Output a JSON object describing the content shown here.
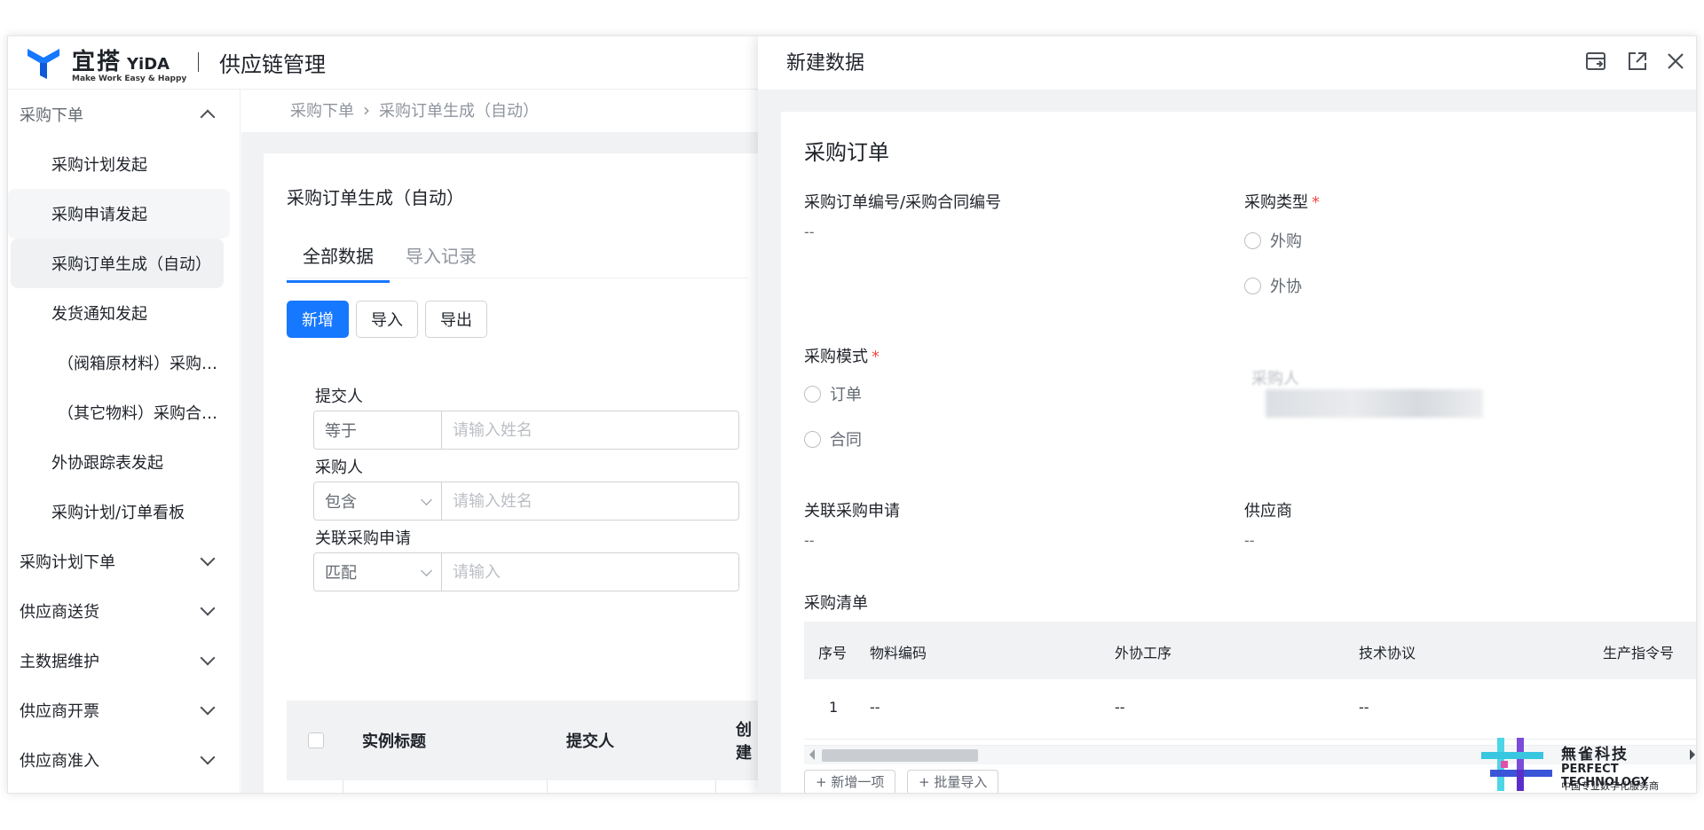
{
  "header": {
    "brand_cn": "宜搭",
    "brand_en": "YiDA",
    "brand_slogan": "Make Work Easy & Happy",
    "app_title": "供应链管理",
    "brand_color": "#1677ff"
  },
  "sidebar": {
    "groups": [
      {
        "label": "采购下单",
        "expanded": true
      },
      {
        "label": "采购计划下单"
      },
      {
        "label": "供应商送货"
      },
      {
        "label": "主数据维护"
      },
      {
        "label": "供应商开票"
      },
      {
        "label": "供应商准入"
      }
    ],
    "items": [
      "采购计划发起",
      "采购申请发起",
      "采购订单生成（自动）",
      "发货通知发起",
      "（阀箱原材料）采购…",
      "（其它物料）采购合…",
      "外协跟踪表发起",
      "采购计划/订单看板"
    ],
    "active_item": "采购订单生成（自动）"
  },
  "main": {
    "breadcrumb": [
      "采购下单",
      "采购订单生成（自动）"
    ],
    "page_title": "采购订单生成（自动）",
    "tabs": [
      "全部数据",
      "导入记录"
    ],
    "buttons": {
      "add": "新增",
      "import": "导入",
      "export": "导出"
    },
    "filters": [
      {
        "label": "提交人",
        "operator": "等于",
        "placeholder": "请输入姓名"
      },
      {
        "label": "采购人",
        "operator": "包含",
        "placeholder": "请输入姓名"
      },
      {
        "label": "关联采购申请",
        "operator": "匹配",
        "placeholder": "请输入"
      }
    ],
    "table_headers": [
      "实例标题",
      "提交人",
      "创建"
    ]
  },
  "drawer": {
    "title": "新建数据",
    "form_title": "采购订单",
    "fields": {
      "order_no_label": "采购订单编号/采购合同编号",
      "order_no_value": "--",
      "purchase_type_label": "采购类型",
      "purchase_type_options": [
        "外购",
        "外协"
      ],
      "purchase_mode_label": "采购模式",
      "purchase_mode_options": [
        "订单",
        "合同"
      ],
      "purchaser_label": "采购人",
      "related_request_label": "关联采购申请",
      "related_request_value": "--",
      "supplier_label": "供应商",
      "supplier_value": "--"
    },
    "list_title": "采购清单",
    "list_headers": [
      "序号",
      "物料编码",
      "外协工序",
      "技术协议",
      "生产指令号"
    ],
    "list_row": [
      "1",
      "--",
      "--",
      "--"
    ],
    "sub_buttons": [
      "+ 新增一项",
      "+ 批量导入"
    ]
  },
  "watermark": {
    "cn": "無雀科技",
    "en": "PERFECT TECHNOLOGY",
    "sub": "中国专业数字化服务商"
  },
  "colors": {
    "primary": "#1677ff",
    "required": "#f54a45",
    "muted": "#8f959e"
  }
}
